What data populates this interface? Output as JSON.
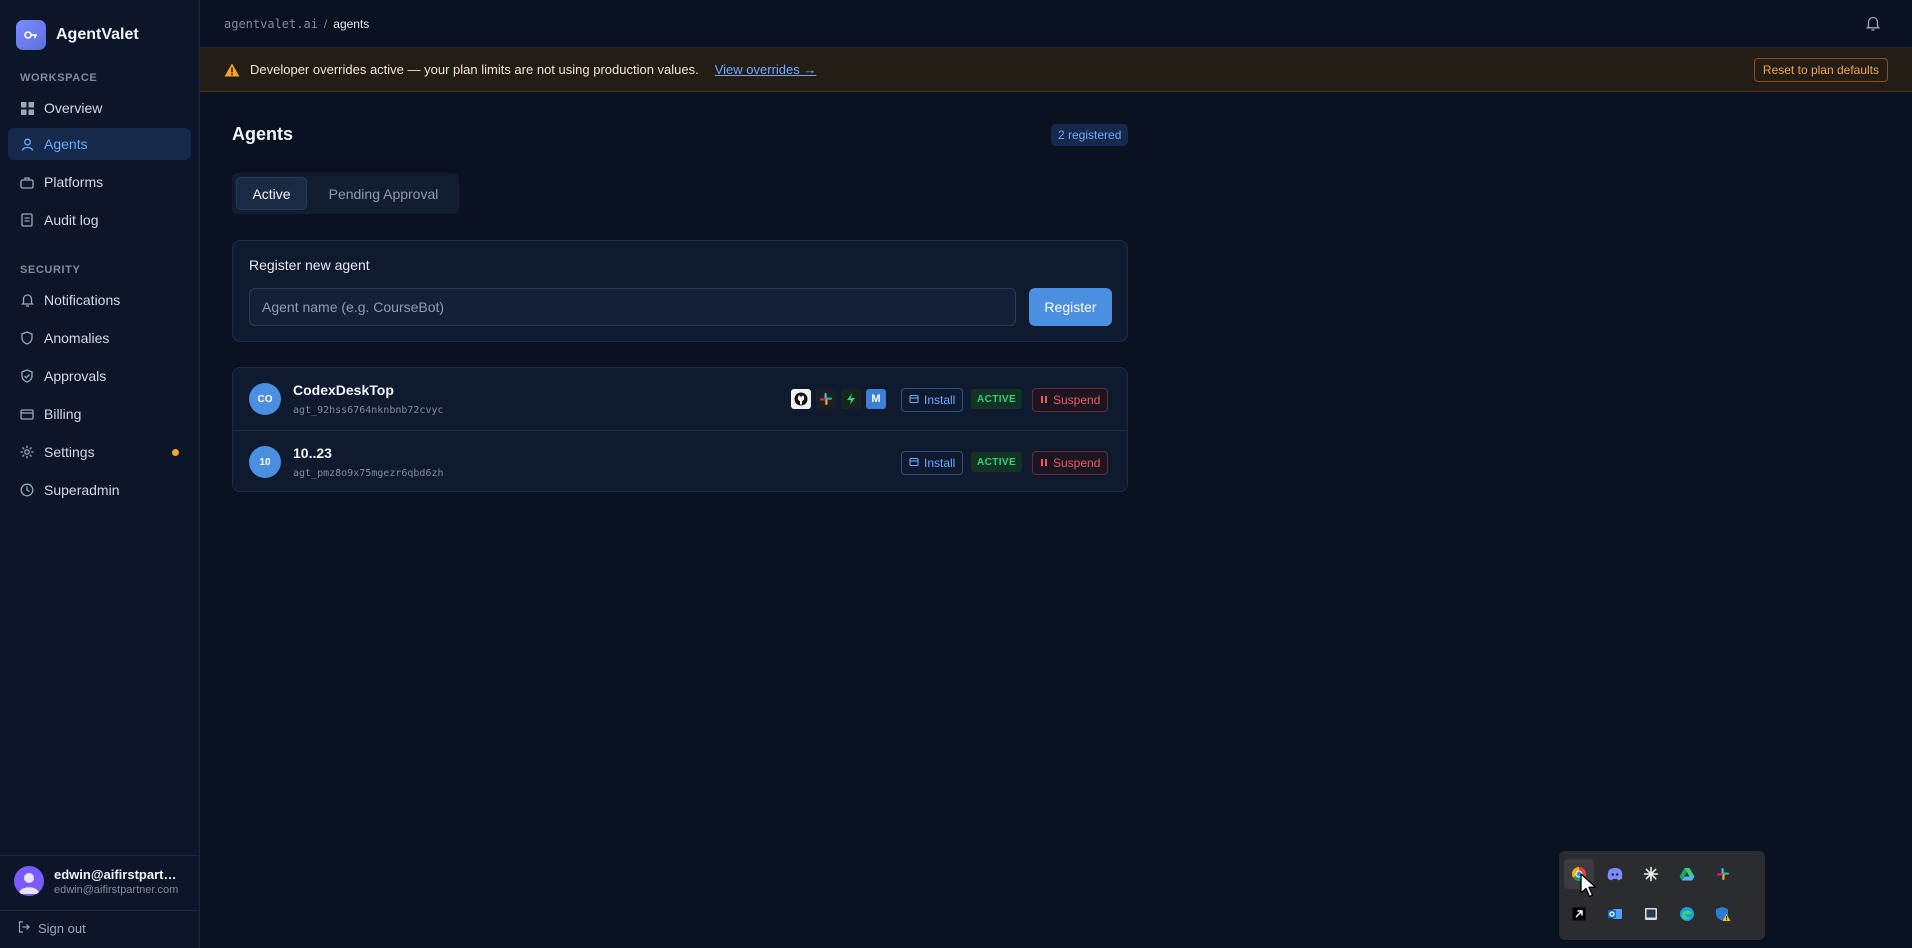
{
  "app": {
    "name": "AgentValet",
    "brand_color": "#6b7cf0"
  },
  "sidebar": {
    "sections": [
      {
        "label": "WORKSPACE"
      },
      {
        "label": "SECURITY"
      }
    ],
    "items": [
      {
        "label": "Overview",
        "icon": "grid-icon"
      },
      {
        "label": "Agents",
        "icon": "user-icon",
        "active": true
      },
      {
        "label": "Platforms",
        "icon": "briefcase-icon"
      },
      {
        "label": "Audit log",
        "icon": "document-icon"
      },
      {
        "label": "Notifications",
        "icon": "bell-icon"
      },
      {
        "label": "Anomalies",
        "icon": "shield-icon"
      },
      {
        "label": "Approvals",
        "icon": "shield-check-icon"
      },
      {
        "label": "Billing",
        "icon": "credit-card-icon"
      },
      {
        "label": "Settings",
        "icon": "gear-icon",
        "has_dot": true
      },
      {
        "label": "Superadmin",
        "icon": "clock-icon"
      }
    ],
    "user": {
      "name": "edwin@aifirstpartner....",
      "email": "edwin@aifirstpartner.com"
    },
    "signout_label": "Sign out"
  },
  "topbar": {
    "breadcrumb_root": "agentvalet.ai",
    "breadcrumb_sep": "/",
    "breadcrumb_current": "agents"
  },
  "banner": {
    "text": "Developer overrides active — your plan limits are not using production values.",
    "link_label": "View overrides →",
    "reset_label": "Reset to plan defaults"
  },
  "main": {
    "title": "Agents",
    "count_badge": "2 registered",
    "tabs": [
      {
        "label": "Active"
      },
      {
        "label": "Pending Approval"
      }
    ],
    "register": {
      "title": "Register new agent",
      "placeholder": "Agent name (e.g. CourseBot)",
      "button_label": "Register"
    },
    "agents": [
      {
        "initials": "CO",
        "name": "CodexDeskTop",
        "id": "agt_92hss6764nknbnb72cvyc",
        "platforms": [
          "github-icon",
          "slack-icon",
          "zap-icon",
          "m-icon"
        ],
        "install_label": "Install",
        "status": "ACTIVE",
        "suspend_label": "Suspend"
      },
      {
        "initials": "10",
        "name": "10..23",
        "id": "agt_pmz8o9x75mgezr6qbd6zh",
        "platforms": [],
        "install_label": "Install",
        "status": "ACTIVE",
        "suspend_label": "Suspend"
      }
    ]
  },
  "tray": {
    "icons": [
      "chrome-icon",
      "discord-icon",
      "claude-icon",
      "drive-icon",
      "slack-icon",
      "cursor-app-icon",
      "outlook-icon",
      "window-icon",
      "edge-icon",
      "defender-icon"
    ]
  }
}
